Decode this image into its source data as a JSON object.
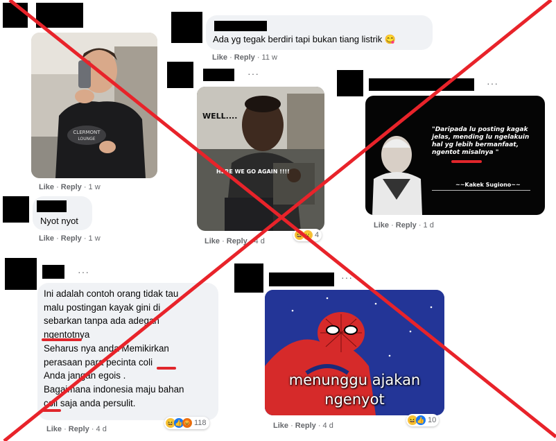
{
  "colors": {
    "bubble": "#f0f2f5",
    "meta": "#65676b",
    "cross": "#e8232a",
    "censor": "#e0262b"
  },
  "comments": [
    {
      "id": "c1",
      "actions": {
        "like": "Like",
        "reply": "Reply",
        "time": "1 w"
      }
    },
    {
      "id": "c2",
      "text": "Ada yg tegak berdiri tapi bukan tiang listrik",
      "emoji": "😋",
      "actions": {
        "like": "Like",
        "reply": "Reply",
        "time": "11 w"
      }
    },
    {
      "id": "c3",
      "meme_text": [
        "WELL....",
        "HERE WE GO AGAIN !!!!"
      ],
      "actions": {
        "like": "Like",
        "reply": "Reply",
        "time": "4 d"
      },
      "reactions": {
        "count": "4"
      }
    },
    {
      "id": "c4",
      "quote": "\"Daripada lu posting kagak jelas, mending lu ngelakuin hal yg lebih bermanfaat, ngentot misalnya \"",
      "attribution": "~~Kakek Sugiono~~",
      "actions": {
        "like": "Like",
        "reply": "Reply",
        "time": "1 d"
      }
    },
    {
      "id": "c5",
      "text": "Nyot nyot",
      "actions": {
        "like": "Like",
        "reply": "Reply",
        "time": "1 w"
      }
    },
    {
      "id": "c6",
      "lines": [
        "Ini adalah contoh orang tidak tau",
        "malu postingan kayak gini di",
        "sebarkan tanpa ada adegan",
        "ngentotnya",
        "Seharus nya anda Memikirkan",
        "perasaan para pecinta coli",
        "Anda jangan egois .",
        "Bagaimana indonesia maju bahan",
        "coli saja anda persulit."
      ],
      "actions": {
        "like": "Like",
        "reply": "Reply",
        "time": "4 d"
      },
      "reactions": {
        "count": "118"
      }
    },
    {
      "id": "c7",
      "meme_caption": [
        "menunggu ajakan",
        "ngenyot"
      ],
      "actions": {
        "like": "Like",
        "reply": "Reply",
        "time": "4 d"
      },
      "reactions": {
        "count": "10"
      }
    }
  ],
  "icons": {
    "more": "more-icon",
    "haha": "haha-emoji-icon",
    "angry": "angry-emoji-icon",
    "like": "like-reaction-icon",
    "wow": "wow-emoji-icon"
  },
  "more_glyph": "···"
}
